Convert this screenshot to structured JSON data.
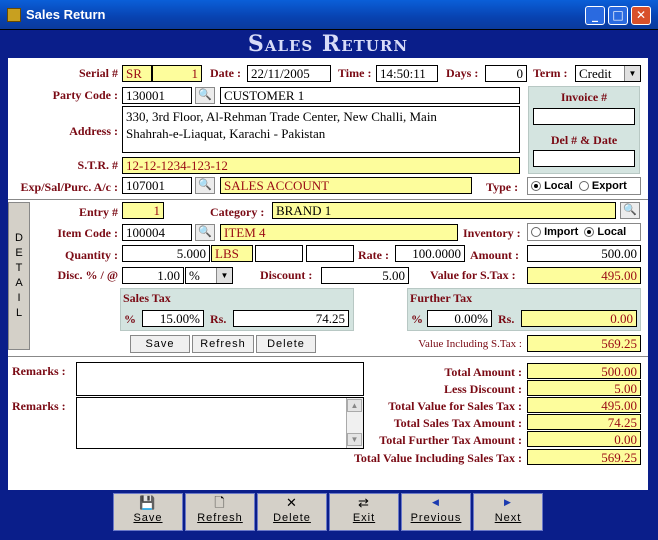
{
  "window": {
    "title": "Sales Return",
    "minimize": "_",
    "maximize": "□",
    "close": "✕"
  },
  "banner": "Sales Return",
  "header": {
    "serial_label": "Serial #",
    "serial_prefix": "SR",
    "serial_no": "1",
    "date_label": "Date :",
    "date": "22/11/2005",
    "time_label": "Time :",
    "time": "14:50:11",
    "days_label": "Days :",
    "days": "0",
    "term_label": "Term :",
    "term": "Credit"
  },
  "party": {
    "code_label": "Party Code :",
    "code": "130001",
    "name": "CUSTOMER 1",
    "address_label": "Address :",
    "address_line1": "330, 3rd Floor, Al-Rehman Trade Center, New Challi, Main",
    "address_line2": "Shahrah-e-Liaquat, Karachi - Pakistan",
    "str_label": "S.T.R. #",
    "str": "12-12-1234-123-12",
    "invoice_label": "Invoice #",
    "invoice": "",
    "del_label": "Del # & Date",
    "del": ""
  },
  "account": {
    "label": "Exp/Sal/Purc. A/c :",
    "code": "107001",
    "name": "SALES ACCOUNT",
    "type_label": "Type :",
    "type_local": "Local",
    "type_export": "Export"
  },
  "detail": {
    "side_tab": [
      "D",
      "E",
      "T",
      "A",
      "I",
      "L"
    ],
    "entry_label": "Entry #",
    "entry": "1",
    "category_label": "Category :",
    "category": "BRAND 1",
    "item_label": "Item Code :",
    "item_code": "100004",
    "item_name": "ITEM 4",
    "inventory_label": "Inventory :",
    "inv_import": "Import",
    "inv_local": "Local",
    "qty_label": "Quantity :",
    "qty": "5.000",
    "unit": "LBS",
    "rate_label": "Rate :",
    "rate": "100.0000",
    "amount_label": "Amount :",
    "amount": "500.00",
    "disc_label": "Disc. % / @",
    "disc": "1.00",
    "disc_type": "%",
    "discount_label": "Discount :",
    "discount": "5.00",
    "vst_label": "Value for S.Tax :",
    "vst": "495.00",
    "sales_tax_label": "Sales Tax",
    "st_pct_label": "%",
    "st_pct": "15.00%",
    "st_rs_label": "Rs.",
    "st_rs": "74.25",
    "further_tax_label": "Further Tax",
    "ft_pct_label": "%",
    "ft_pct": "0.00%",
    "ft_rs_label": "Rs.",
    "ft_rs": "0.00",
    "save": "Save",
    "refresh": "Refresh",
    "delete": "Delete",
    "vist_label": "Value Including S.Tax :",
    "vist": "569.25"
  },
  "remarks": {
    "label1": "Remarks :",
    "value1": "",
    "label2": "Remarks :",
    "value2": ""
  },
  "totals": [
    {
      "label": "Total Amount :",
      "value": "500.00"
    },
    {
      "label": "Less Discount :",
      "value": "5.00"
    },
    {
      "label": "Total Value for Sales Tax :",
      "value": "495.00"
    },
    {
      "label": "Total Sales Tax Amount :",
      "value": "74.25"
    },
    {
      "label": "Total Further Tax Amount :",
      "value": "0.00"
    },
    {
      "label": "Total Value Including Sales Tax :",
      "value": "569.25"
    }
  ],
  "toolbar": {
    "save": "Save",
    "refresh": "Refresh",
    "delete": "Delete",
    "exit": "Exit",
    "previous": "Previous",
    "next": "Next"
  }
}
